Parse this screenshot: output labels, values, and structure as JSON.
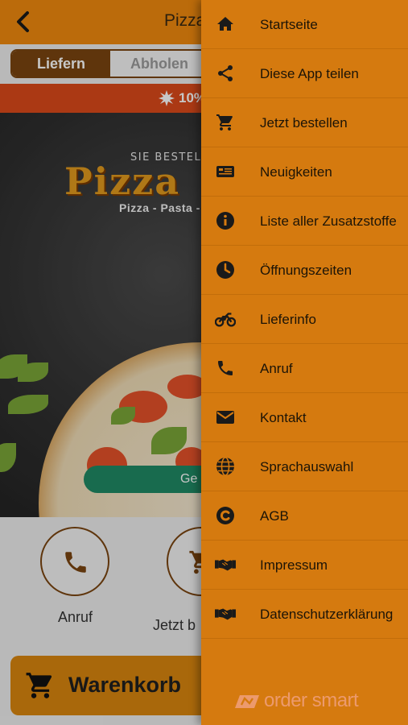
{
  "app": {
    "title": "Pizza",
    "toggle": {
      "delivery_label": "Liefern",
      "pickup_label": "Abholen"
    },
    "promo_text": "10%",
    "hero": {
      "tagline": "SIE BESTELLEN,",
      "logo_text": "Pizza",
      "subline": "Pizza - Pasta - K",
      "status_text": "Ge"
    },
    "actions": [
      {
        "label": "Anruf",
        "icon": "phone-icon"
      },
      {
        "label": "Jetzt b",
        "icon": "cart-icon"
      }
    ],
    "cart_label": "Warenkorb",
    "colors": {
      "topbar": "#f0890f",
      "accent_brown": "#7a4510",
      "promo": "#dc4a1a",
      "status": "#1f8a64"
    }
  },
  "drawer": {
    "items": [
      {
        "label": "Startseite",
        "icon": "home-icon"
      },
      {
        "label": "Diese App teilen",
        "icon": "share-icon"
      },
      {
        "label": "Jetzt bestellen",
        "icon": "cart-icon"
      },
      {
        "label": "Neuigkeiten",
        "icon": "news-icon"
      },
      {
        "label": "Liste aller Zusatzstoffe",
        "icon": "info-icon"
      },
      {
        "label": "Öffnungszeiten",
        "icon": "clock-icon"
      },
      {
        "label": "Lieferinfo",
        "icon": "motorcycle-icon"
      },
      {
        "label": "Anruf",
        "icon": "phone-icon"
      },
      {
        "label": "Kontakt",
        "icon": "envelope-icon"
      },
      {
        "label": "Sprachauswahl",
        "icon": "globe-icon"
      },
      {
        "label": "AGB",
        "icon": "copyright-icon"
      },
      {
        "label": "Impressum",
        "icon": "handshake-icon"
      },
      {
        "label": "Datenschutzerklärung",
        "icon": "handshake-icon"
      }
    ],
    "brand": "order smart",
    "colors": {
      "background": "#d57a0f",
      "divider": "#c26d0a"
    }
  }
}
